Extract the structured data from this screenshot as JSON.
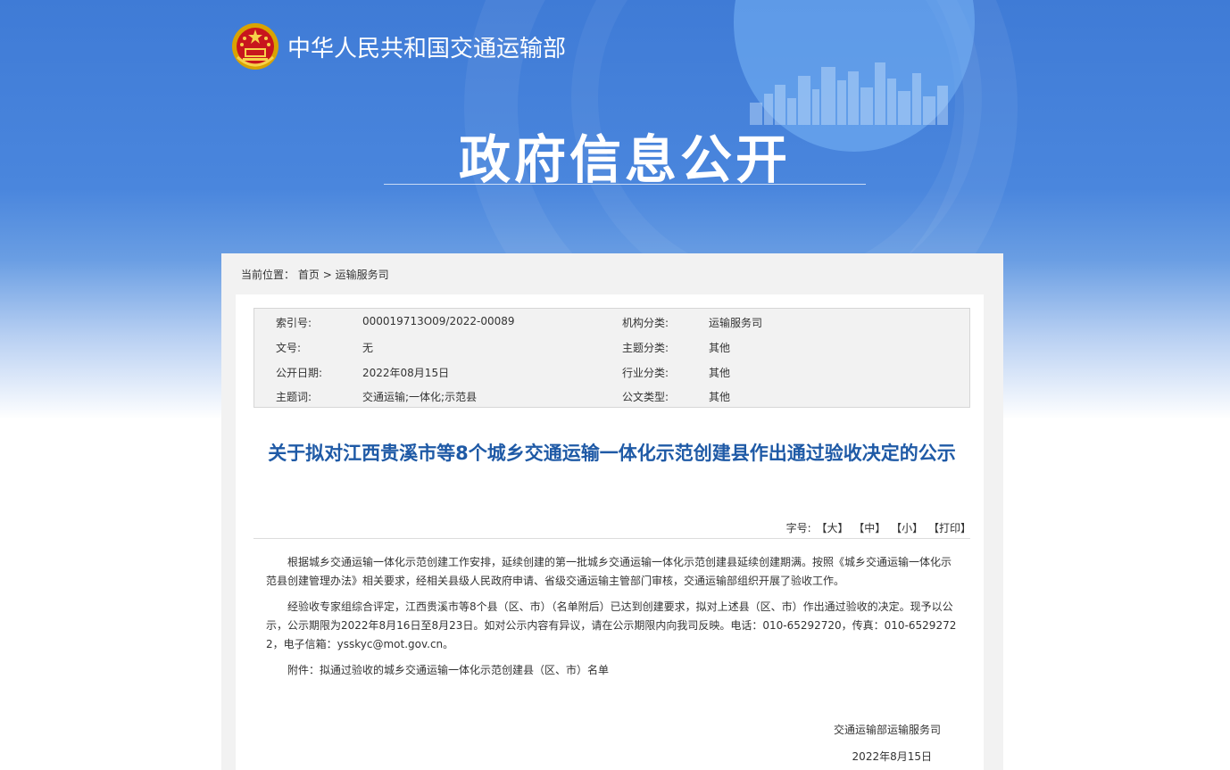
{
  "header": {
    "site_name": "中华人民共和国交通运输部",
    "main_heading": "政府信息公开"
  },
  "breadcrumb": {
    "prefix": "当前位置：",
    "home": "首页",
    "separator": ">",
    "section": "运输服务司"
  },
  "meta": {
    "rows": [
      {
        "k1": "索引号:",
        "v1": "000019713O09/2022-00089",
        "k2": "机构分类:",
        "v2": "运输服务司"
      },
      {
        "k1": "文号:",
        "v1": "无",
        "k2": "主题分类:",
        "v2": "其他"
      },
      {
        "k1": "公开日期:",
        "v1": "2022年08月15日",
        "k2": "行业分类:",
        "v2": "其他"
      },
      {
        "k1": "主题词:",
        "v1": "交通运输;一体化;示范县",
        "k2": "公文类型:",
        "v2": "其他"
      }
    ]
  },
  "article": {
    "title": "关于拟对江西贵溪市等8个城乡交通运输一体化示范创建县作出通过验收决定的公示",
    "font_label": "字号:",
    "font_large": "【大】",
    "font_medium": "【中】",
    "font_small": "【小】",
    "print": "【打印】",
    "paragraphs": [
      "根据城乡交通运输一体化示范创建工作安排，延续创建的第一批城乡交通运输一体化示范创建县延续创建期满。按照《城乡交通运输一体化示范县创建管理办法》相关要求，经相关县级人民政府申请、省级交通运输主管部门审核，交通运输部组织开展了验收工作。",
      "经验收专家组综合评定，江西贵溪市等8个县（区、市）（名单附后）已达到创建要求，拟对上述县（区、市）作出通过验收的决定。现予以公示，公示期限为2022年8月16日至8月23日。如对公示内容有异议，请在公示期限内向我司反映。电话：010-65292720，传真：010-65292722，电子信箱：ysskyc@mot.gov.cn。",
      "附件：拟通过验收的城乡交通运输一体化示范创建县（区、市）名单"
    ],
    "signature": "交通运输部运输服务司",
    "date": "2022年8月15日"
  }
}
